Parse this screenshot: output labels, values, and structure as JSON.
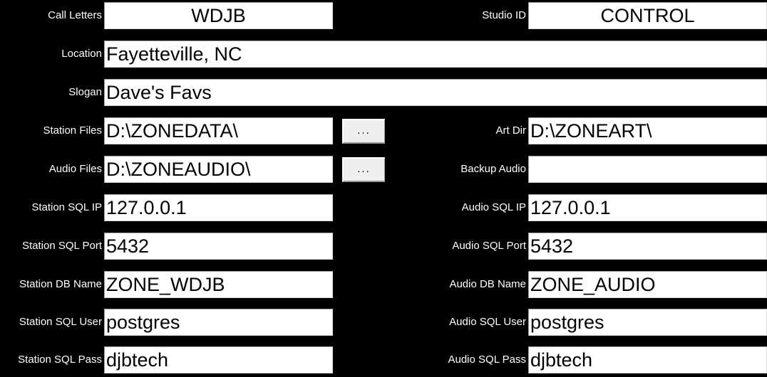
{
  "form": {
    "rows": [
      {
        "left": {
          "label": "Call Letters",
          "value": "WDJB",
          "align": "center",
          "browse": false
        },
        "right": {
          "label": "Studio ID",
          "value": "CONTROL",
          "align": "center",
          "browse": false
        }
      },
      {
        "full": {
          "label": "Location",
          "value": "Fayetteville, NC",
          "align": "left",
          "browse": false
        }
      },
      {
        "full": {
          "label": "Slogan",
          "value": "Dave's Favs",
          "align": "left",
          "browse": false
        }
      },
      {
        "left": {
          "label": "Station Files",
          "value": "D:\\ZONEDATA\\",
          "align": "left",
          "browse": true
        },
        "right": {
          "label": "Art Dir",
          "value": "D:\\ZONEART\\",
          "align": "left",
          "browse": false
        }
      },
      {
        "left": {
          "label": "Audio Files",
          "value": "D:\\ZONEAUDIO\\",
          "align": "left",
          "browse": true
        },
        "right": {
          "label": "Backup Audio",
          "value": "",
          "align": "left",
          "browse": false
        }
      },
      {
        "left": {
          "label": "Station SQL IP",
          "value": "127.0.0.1",
          "align": "left",
          "browse": false
        },
        "right": {
          "label": "Audio SQL IP",
          "value": "127.0.0.1",
          "align": "left",
          "browse": false
        }
      },
      {
        "left": {
          "label": "Station SQL Port",
          "value": "5432",
          "align": "left",
          "browse": false
        },
        "right": {
          "label": "Audio SQL Port",
          "value": "5432",
          "align": "left",
          "browse": false
        }
      },
      {
        "left": {
          "label": "Station DB Name",
          "value": "ZONE_WDJB",
          "align": "left",
          "browse": false
        },
        "right": {
          "label": "Audio DB Name",
          "value": "ZONE_AUDIO",
          "align": "left",
          "browse": false
        }
      },
      {
        "left": {
          "label": "Station SQL User",
          "value": "postgres",
          "align": "left",
          "browse": false
        },
        "right": {
          "label": "Audio SQL User",
          "value": "postgres",
          "align": "left",
          "browse": false
        }
      },
      {
        "left": {
          "label": "Station SQL Pass",
          "value": "djbtech",
          "align": "left",
          "browse": false
        },
        "right": {
          "label": "Audio SQL Pass",
          "value": "djbtech",
          "align": "left",
          "browse": false
        }
      }
    ],
    "browse_button_label": "...",
    "colors": {
      "background": "#000000",
      "label_text": "#ffffff",
      "field_background": "#ffffff",
      "field_text": "#000000",
      "button_face": "#efefef"
    }
  }
}
